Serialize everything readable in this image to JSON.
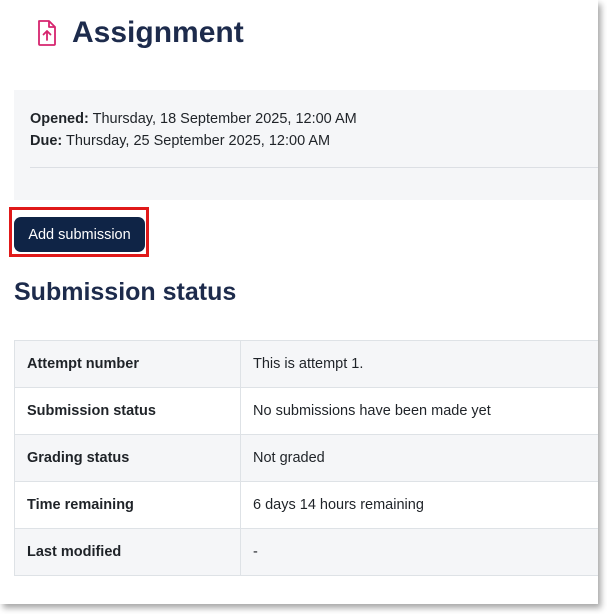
{
  "header": {
    "title": "Assignment",
    "icon": "assignment-upload-icon",
    "icon_color": "#d6246e"
  },
  "dates": {
    "opened_label": "Opened:",
    "opened_value": "Thursday, 18 September 2025, 12:00 AM",
    "due_label": "Due:",
    "due_value": "Thursday, 25 September 2025, 12:00 AM"
  },
  "actions": {
    "add_submission_label": "Add submission",
    "button_color": "#0f2446",
    "highlight_color": "#e01919"
  },
  "submission_status": {
    "title": "Submission status",
    "rows": [
      {
        "label": "Attempt number",
        "value": "This is attempt 1."
      },
      {
        "label": "Submission status",
        "value": "No submissions have been made yet"
      },
      {
        "label": "Grading status",
        "value": "Not graded"
      },
      {
        "label": "Time remaining",
        "value": "6 days 14 hours remaining"
      },
      {
        "label": "Last modified",
        "value": "-"
      }
    ]
  }
}
